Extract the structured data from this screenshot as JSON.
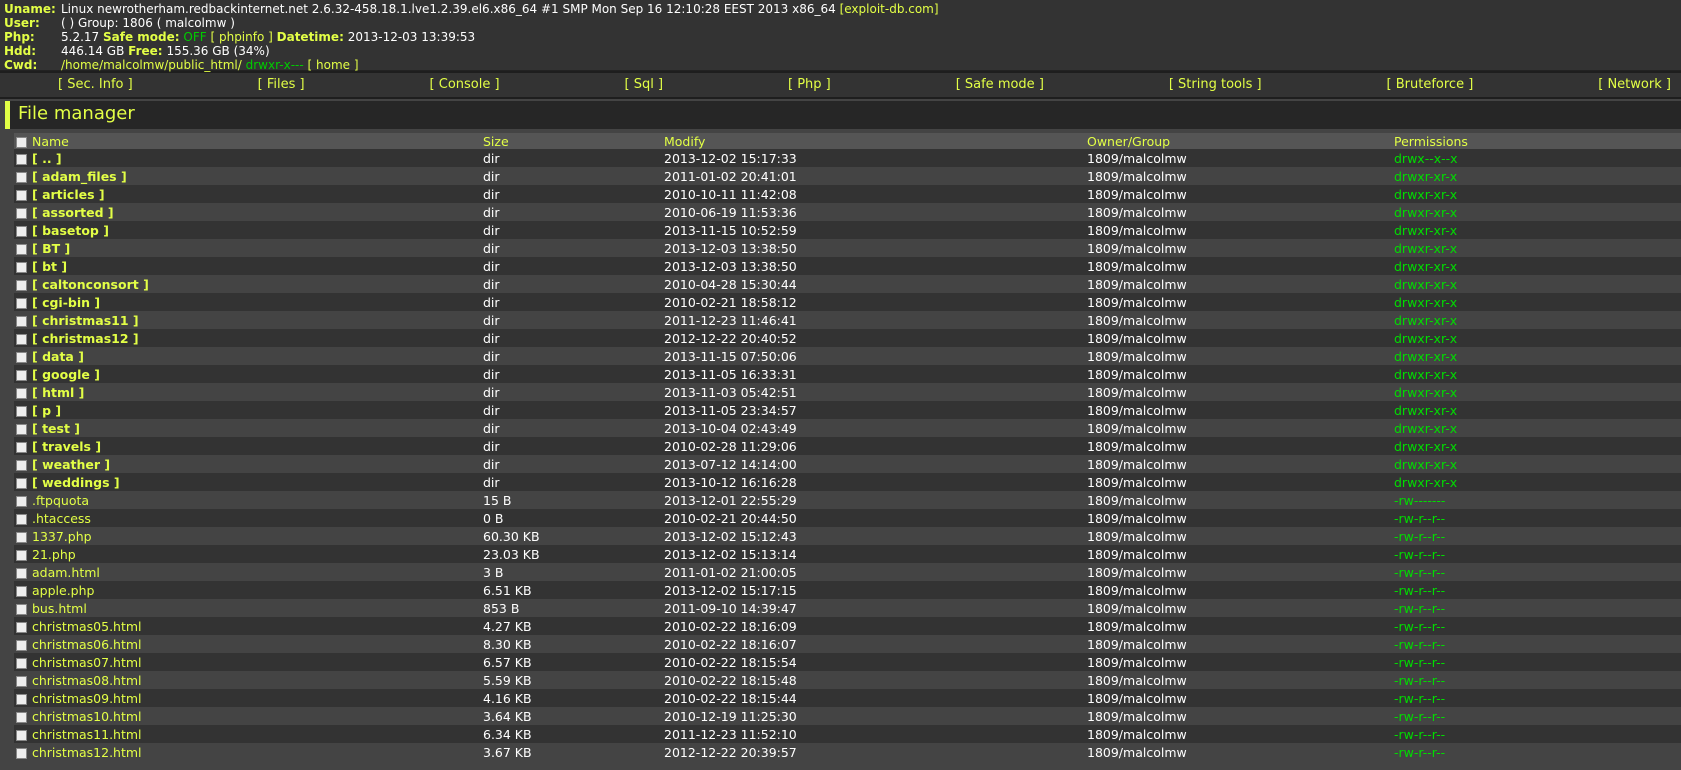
{
  "info": {
    "uname_label": "Uname:",
    "uname_value": "Linux newrotherham.redbackinternet.net 2.6.32-458.18.1.lve1.2.39.el6.x86_64 #1 SMP Mon Sep 16 12:10:28 EEST 2013 x86_64",
    "exploit_link": "[exploit-db.com]",
    "user_label": "User:",
    "user_value": "( ) Group: 1806 ( malcolmw )",
    "php_label": "Php:",
    "php_version": "5.2.17",
    "safe_mode_label": "Safe mode:",
    "safe_mode_value": "OFF",
    "phpinfo_link": "[ phpinfo ]",
    "datetime_label": "Datetime:",
    "datetime_value": "2013-12-03 13:39:53",
    "hdd_label": "Hdd:",
    "hdd_value": "446.14 GB",
    "free_label": "Free:",
    "free_value": "155.36 GB (34%)",
    "cwd_label": "Cwd:",
    "cwd_path": "/home/malcolmw/public_html/",
    "cwd_perm": "drwxr-x---",
    "home_link": "[ home ]"
  },
  "menu": [
    "[ Sec. Info ]",
    "[ Files ]",
    "[ Console ]",
    "[ Sql ]",
    "[ Php ]",
    "[ Safe mode ]",
    "[ String tools ]",
    "[ Bruteforce ]",
    "[ Network ]"
  ],
  "section_title": "File manager",
  "columns": {
    "name": "Name",
    "size": "Size",
    "modify": "Modify",
    "owner": "Owner/Group",
    "perms": "Permissions"
  },
  "rows": [
    {
      "name": "[ .. ]",
      "type": "dir",
      "size": "dir",
      "modify": "2013-12-02 15:17:33",
      "owner": "1809/malcolmw",
      "perms": "drwx--x--x"
    },
    {
      "name": "[ adam_files ]",
      "type": "dir",
      "size": "dir",
      "modify": "2011-01-02 20:41:01",
      "owner": "1809/malcolmw",
      "perms": "drwxr-xr-x"
    },
    {
      "name": "[ articles ]",
      "type": "dir",
      "size": "dir",
      "modify": "2010-10-11 11:42:08",
      "owner": "1809/malcolmw",
      "perms": "drwxr-xr-x"
    },
    {
      "name": "[ assorted ]",
      "type": "dir",
      "size": "dir",
      "modify": "2010-06-19 11:53:36",
      "owner": "1809/malcolmw",
      "perms": "drwxr-xr-x"
    },
    {
      "name": "[ basetop ]",
      "type": "dir",
      "size": "dir",
      "modify": "2013-11-15 10:52:59",
      "owner": "1809/malcolmw",
      "perms": "drwxr-xr-x"
    },
    {
      "name": "[ BT ]",
      "type": "dir",
      "size": "dir",
      "modify": "2013-12-03 13:38:50",
      "owner": "1809/malcolmw",
      "perms": "drwxr-xr-x"
    },
    {
      "name": "[ bt ]",
      "type": "dir",
      "size": "dir",
      "modify": "2013-12-03 13:38:50",
      "owner": "1809/malcolmw",
      "perms": "drwxr-xr-x"
    },
    {
      "name": "[ caltonconsort ]",
      "type": "dir",
      "size": "dir",
      "modify": "2010-04-28 15:30:44",
      "owner": "1809/malcolmw",
      "perms": "drwxr-xr-x"
    },
    {
      "name": "[ cgi-bin ]",
      "type": "dir",
      "size": "dir",
      "modify": "2010-02-21 18:58:12",
      "owner": "1809/malcolmw",
      "perms": "drwxr-xr-x"
    },
    {
      "name": "[ christmas11 ]",
      "type": "dir",
      "size": "dir",
      "modify": "2011-12-23 11:46:41",
      "owner": "1809/malcolmw",
      "perms": "drwxr-xr-x"
    },
    {
      "name": "[ christmas12 ]",
      "type": "dir",
      "size": "dir",
      "modify": "2012-12-22 20:40:52",
      "owner": "1809/malcolmw",
      "perms": "drwxr-xr-x"
    },
    {
      "name": "[ data ]",
      "type": "dir",
      "size": "dir",
      "modify": "2013-11-15 07:50:06",
      "owner": "1809/malcolmw",
      "perms": "drwxr-xr-x"
    },
    {
      "name": "[ google ]",
      "type": "dir",
      "size": "dir",
      "modify": "2013-11-05 16:33:31",
      "owner": "1809/malcolmw",
      "perms": "drwxr-xr-x"
    },
    {
      "name": "[ html ]",
      "type": "dir",
      "size": "dir",
      "modify": "2013-11-03 05:42:51",
      "owner": "1809/malcolmw",
      "perms": "drwxr-xr-x"
    },
    {
      "name": "[ p ]",
      "type": "dir",
      "size": "dir",
      "modify": "2013-11-05 23:34:57",
      "owner": "1809/malcolmw",
      "perms": "drwxr-xr-x"
    },
    {
      "name": "[ test ]",
      "type": "dir",
      "size": "dir",
      "modify": "2013-10-04 02:43:49",
      "owner": "1809/malcolmw",
      "perms": "drwxr-xr-x"
    },
    {
      "name": "[ travels ]",
      "type": "dir",
      "size": "dir",
      "modify": "2010-02-28 11:29:06",
      "owner": "1809/malcolmw",
      "perms": "drwxr-xr-x"
    },
    {
      "name": "[ weather ]",
      "type": "dir",
      "size": "dir",
      "modify": "2013-07-12 14:14:00",
      "owner": "1809/malcolmw",
      "perms": "drwxr-xr-x"
    },
    {
      "name": "[ weddings ]",
      "type": "dir",
      "size": "dir",
      "modify": "2013-10-12 16:16:28",
      "owner": "1809/malcolmw",
      "perms": "drwxr-xr-x"
    },
    {
      "name": ".ftpquota",
      "type": "file",
      "size": "15 B",
      "modify": "2013-12-01 22:55:29",
      "owner": "1809/malcolmw",
      "perms": "-rw-------"
    },
    {
      "name": ".htaccess",
      "type": "file",
      "size": "0 B",
      "modify": "2010-02-21 20:44:50",
      "owner": "1809/malcolmw",
      "perms": "-rw-r--r--"
    },
    {
      "name": "1337.php",
      "type": "file",
      "size": "60.30 KB",
      "modify": "2013-12-02 15:12:43",
      "owner": "1809/malcolmw",
      "perms": "-rw-r--r--"
    },
    {
      "name": "21.php",
      "type": "file",
      "size": "23.03 KB",
      "modify": "2013-12-02 15:13:14",
      "owner": "1809/malcolmw",
      "perms": "-rw-r--r--"
    },
    {
      "name": "adam.html",
      "type": "file",
      "size": "3 B",
      "modify": "2011-01-02 21:00:05",
      "owner": "1809/malcolmw",
      "perms": "-rw-r--r--"
    },
    {
      "name": "apple.php",
      "type": "file",
      "size": "6.51 KB",
      "modify": "2013-12-02 15:17:15",
      "owner": "1809/malcolmw",
      "perms": "-rw-r--r--"
    },
    {
      "name": "bus.html",
      "type": "file",
      "size": "853 B",
      "modify": "2011-09-10 14:39:47",
      "owner": "1809/malcolmw",
      "perms": "-rw-r--r--"
    },
    {
      "name": "christmas05.html",
      "type": "file",
      "size": "4.27 KB",
      "modify": "2010-02-22 18:16:09",
      "owner": "1809/malcolmw",
      "perms": "-rw-r--r--"
    },
    {
      "name": "christmas06.html",
      "type": "file",
      "size": "8.30 KB",
      "modify": "2010-02-22 18:16:07",
      "owner": "1809/malcolmw",
      "perms": "-rw-r--r--"
    },
    {
      "name": "christmas07.html",
      "type": "file",
      "size": "6.57 KB",
      "modify": "2010-02-22 18:15:54",
      "owner": "1809/malcolmw",
      "perms": "-rw-r--r--"
    },
    {
      "name": "christmas08.html",
      "type": "file",
      "size": "5.59 KB",
      "modify": "2010-02-22 18:15:48",
      "owner": "1809/malcolmw",
      "perms": "-rw-r--r--"
    },
    {
      "name": "christmas09.html",
      "type": "file",
      "size": "4.16 KB",
      "modify": "2010-02-22 18:15:44",
      "owner": "1809/malcolmw",
      "perms": "-rw-r--r--"
    },
    {
      "name": "christmas10.html",
      "type": "file",
      "size": "3.64 KB",
      "modify": "2010-12-19 11:25:30",
      "owner": "1809/malcolmw",
      "perms": "-rw-r--r--"
    },
    {
      "name": "christmas11.html",
      "type": "file",
      "size": "6.34 KB",
      "modify": "2011-12-23 11:52:10",
      "owner": "1809/malcolmw",
      "perms": "-rw-r--r--"
    },
    {
      "name": "christmas12.html",
      "type": "file",
      "size": "3.67 KB",
      "modify": "2012-12-22 20:39:57",
      "owner": "1809/malcolmw",
      "perms": "-rw-r--r--"
    }
  ]
}
